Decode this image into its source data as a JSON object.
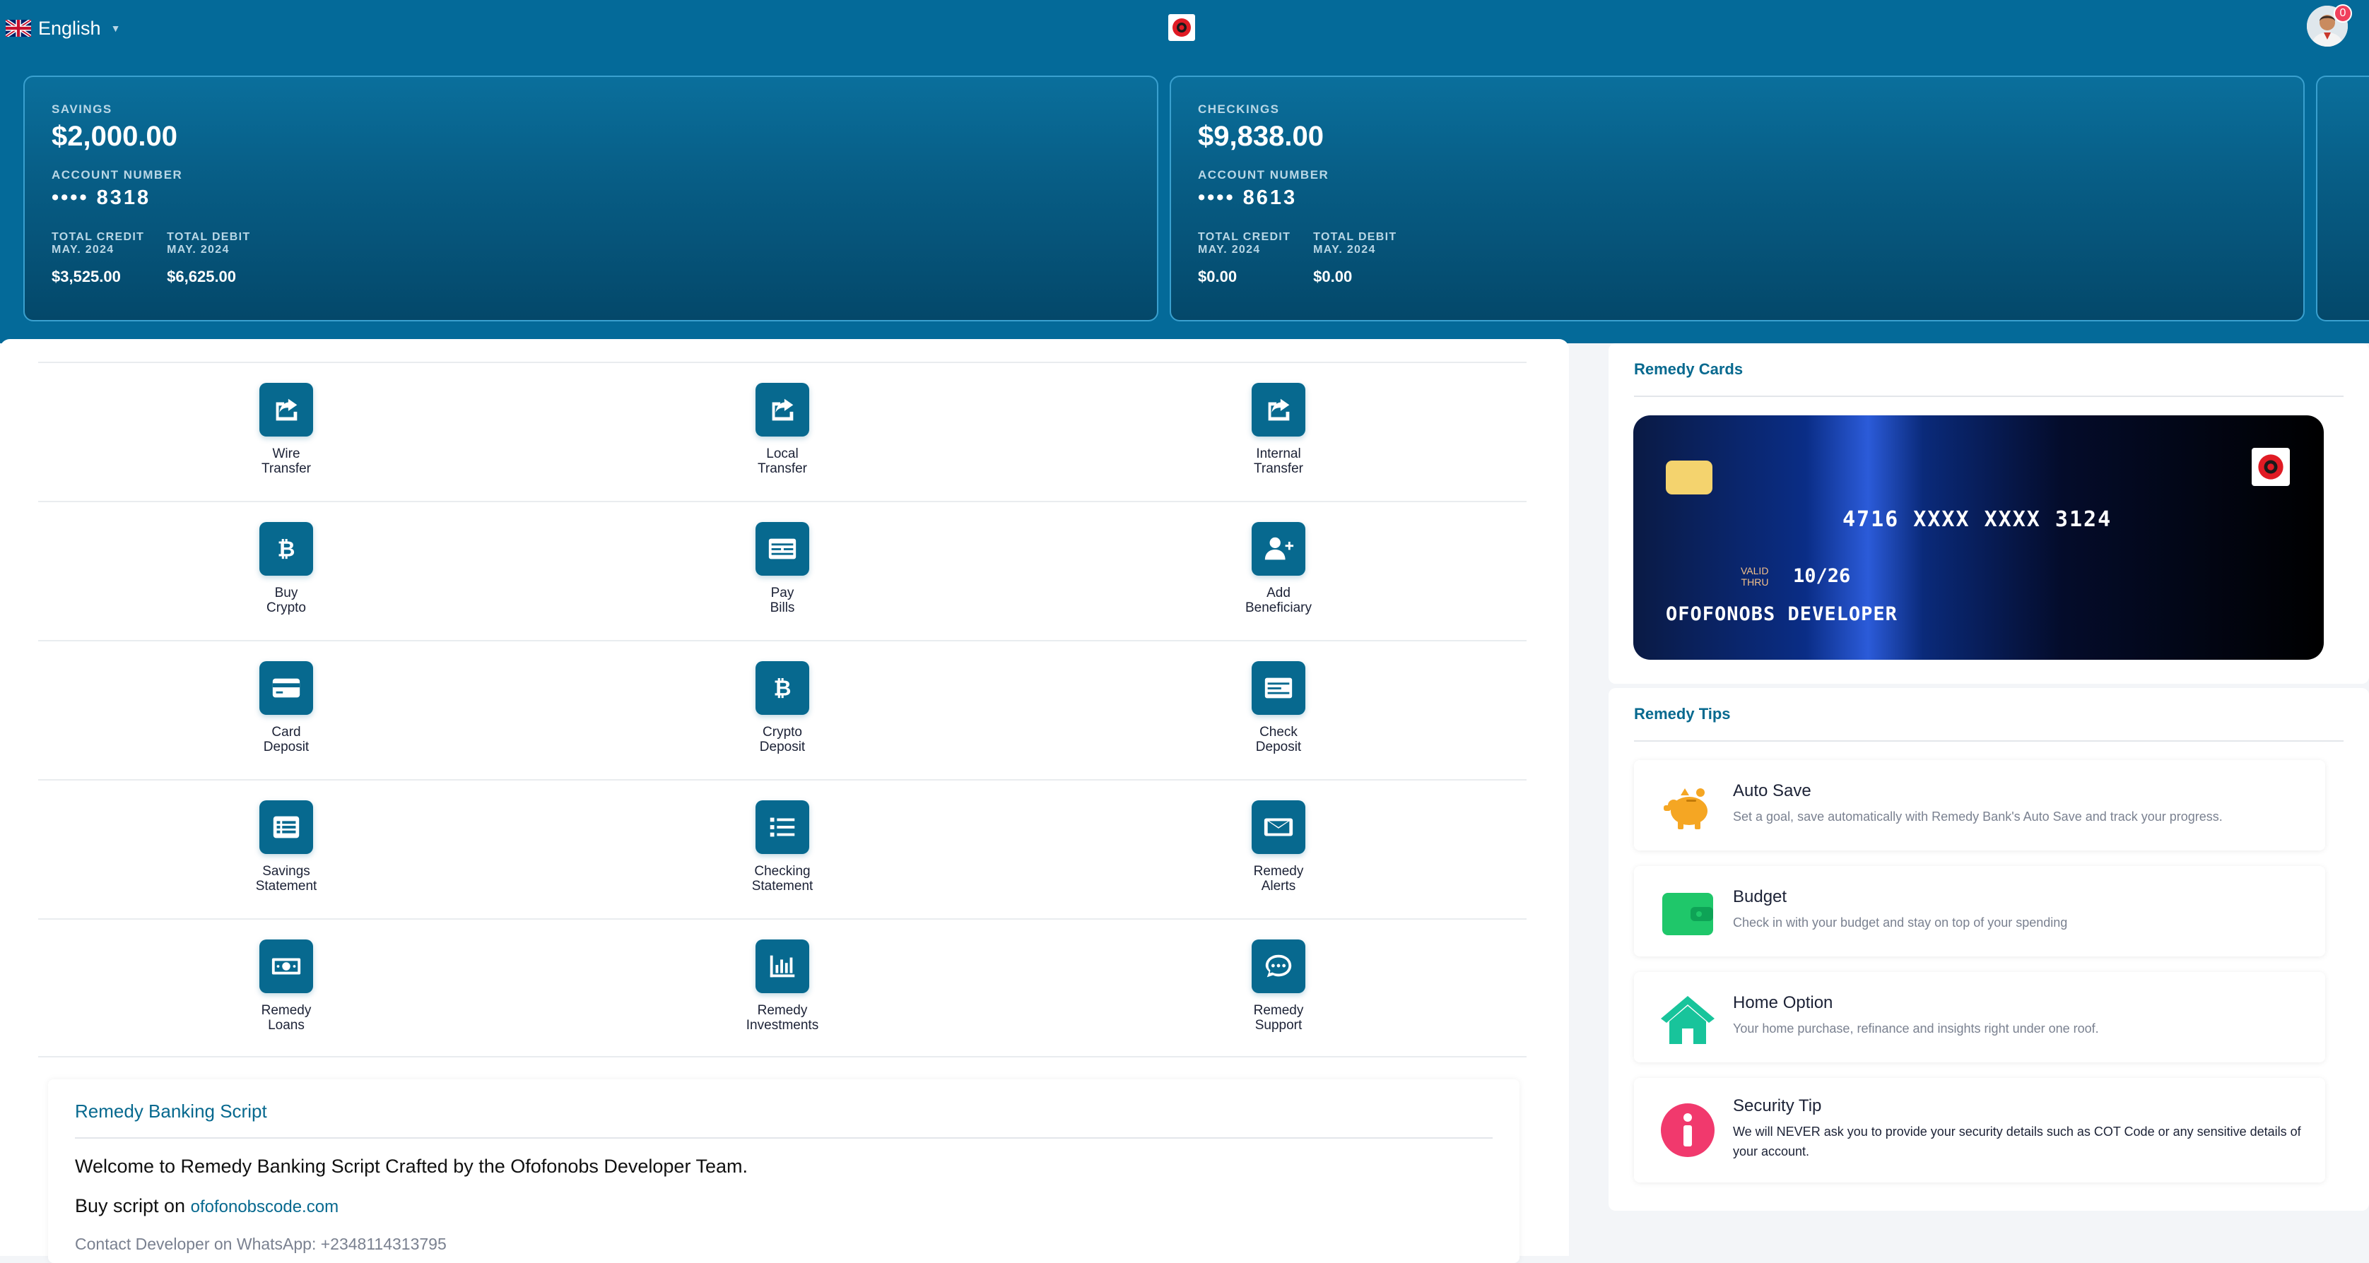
{
  "header": {
    "language": "English",
    "notification_count": "0"
  },
  "accounts": [
    {
      "type": "SAVINGS",
      "balance": "$2,000.00",
      "number_label": "ACCOUNT NUMBER",
      "number": "•••• 8318",
      "credit_label": "TOTAL CREDIT",
      "credit_period": "MAY. 2024",
      "credit_value": "$3,525.00",
      "debit_label": "TOTAL DEBIT",
      "debit_period": "MAY. 2024",
      "debit_value": "$6,625.00"
    },
    {
      "type": "CHECKINGS",
      "balance": "$9,838.00",
      "number_label": "ACCOUNT NUMBER",
      "number": "•••• 8613",
      "credit_label": "TOTAL CREDIT",
      "credit_period": "MAY. 2024",
      "credit_value": "$0.00",
      "debit_label": "TOTAL DEBIT",
      "debit_period": "MAY. 2024",
      "debit_value": "$0.00"
    }
  ],
  "quick_actions": [
    {
      "line1": "Wire",
      "line2": "Transfer",
      "icon": "share-icon"
    },
    {
      "line1": "Local",
      "line2": "Transfer",
      "icon": "share-icon"
    },
    {
      "line1": "Internal",
      "line2": "Transfer",
      "icon": "share-icon"
    },
    {
      "line1": "Buy",
      "line2": "Crypto",
      "icon": "bitcoin-icon"
    },
    {
      "line1": "Pay",
      "line2": "Bills",
      "icon": "bill-icon"
    },
    {
      "line1": "Add",
      "line2": "Beneficiary",
      "icon": "user-plus-icon"
    },
    {
      "line1": "Card",
      "line2": "Deposit",
      "icon": "credit-card-icon"
    },
    {
      "line1": "Crypto",
      "line2": "Deposit",
      "icon": "bitcoin-icon"
    },
    {
      "line1": "Check",
      "line2": "Deposit",
      "icon": "check-icon"
    },
    {
      "line1": "Savings",
      "line2": "Statement",
      "icon": "statement-icon"
    },
    {
      "line1": "Checking",
      "line2": "Statement",
      "icon": "list-icon"
    },
    {
      "line1": "Remedy",
      "line2": "Alerts",
      "icon": "envelope-icon"
    },
    {
      "line1": "Remedy",
      "line2": "Loans",
      "icon": "money-icon"
    },
    {
      "line1": "Remedy",
      "line2": "Investments",
      "icon": "chart-icon"
    },
    {
      "line1": "Remedy",
      "line2": "Support",
      "icon": "chat-icon"
    }
  ],
  "info": {
    "title": "Remedy Banking Script",
    "welcome": "Welcome to Remedy Banking Script Crafted by the Ofofonobs Developer Team.",
    "buy_prefix": "Buy script on",
    "buy_link": "ofofonobscode.com",
    "contact": "Contact Developer on WhatsApp: +2348114313795"
  },
  "cards": {
    "title": "Remedy Cards",
    "number": "4716 XXXX XXXX 3124",
    "valid_line1": "VALID",
    "valid_line2": "THRU",
    "expiry": "10/26",
    "holder": "OFOFONOBS DEVELOPER"
  },
  "tips": {
    "title": "Remedy Tips",
    "items": [
      {
        "title": "Auto Save",
        "text": "Set a goal, save automatically with Remedy Bank's Auto Save and track your progress.",
        "icon": "piggy-bank-icon",
        "color": "#f5a623"
      },
      {
        "title": "Budget",
        "text": "Check in with your budget and stay on top of your spending",
        "icon": "wallet-icon",
        "color": "#1fc76a"
      },
      {
        "title": "Home Option",
        "text": "Your home purchase, refinance and insights right under one roof.",
        "icon": "home-icon",
        "color": "#18c49b"
      },
      {
        "title": "Security Tip",
        "text": "We will NEVER ask you to provide your security details such as COT Code or any sensitive details of your account.",
        "icon": "info-icon",
        "color": "#f1396d"
      }
    ]
  }
}
